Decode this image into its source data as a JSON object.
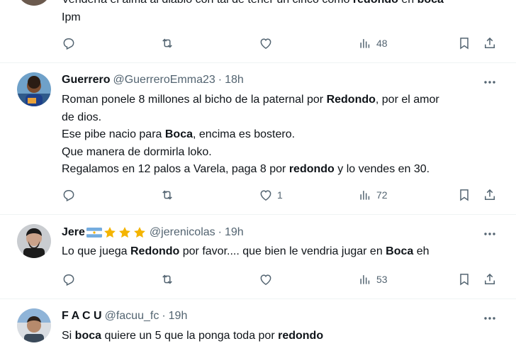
{
  "tweets": [
    {
      "body_lines": [
        [
          {
            "t": "Vendería el alma al diablo con tal de tener un cinco como "
          },
          {
            "t": "redondo",
            "b": true
          },
          {
            "t": " en "
          },
          {
            "t": "boca",
            "b": true
          }
        ],
        [
          {
            "t": "Ipm"
          }
        ]
      ],
      "stats": {
        "views": "48"
      }
    },
    {
      "name": "Guerrero",
      "handle": "@GuerreroEmma23",
      "time": "18h",
      "body_lines": [
        [
          {
            "t": "Roman ponele 8 millones al bicho de la paternal por "
          },
          {
            "t": "Redondo",
            "b": true
          },
          {
            "t": ", por el amor"
          }
        ],
        [
          {
            "t": "de dios."
          }
        ],
        [
          {
            "t": "Ese pibe nacio para "
          },
          {
            "t": "Boca",
            "b": true
          },
          {
            "t": ", encima es bostero."
          }
        ],
        [
          {
            "t": "Que manera de dormirla loko."
          }
        ],
        [
          {
            "t": "Regalamos en 12 palos a Varela, paga 8 por "
          },
          {
            "t": "redondo",
            "b": true
          },
          {
            "t": " y lo vendes en 30."
          }
        ]
      ],
      "stats": {
        "likes": "1",
        "views": "72"
      }
    },
    {
      "name": "Jere",
      "handle": "@jerenicolas",
      "time": "19h",
      "body_lines": [
        [
          {
            "t": "Lo que juega "
          },
          {
            "t": "Redondo",
            "b": true
          },
          {
            "t": " por favor.... que bien le vendria jugar en "
          },
          {
            "t": "Boca",
            "b": true
          },
          {
            "t": " eh"
          }
        ]
      ],
      "stats": {
        "views": "53"
      }
    },
    {
      "name": "F A C U",
      "handle": "@facuu_fc",
      "time": "19h",
      "body_lines": [
        [
          {
            "t": "Si "
          },
          {
            "t": "boca",
            "b": true
          },
          {
            "t": " quiere un 5 que la ponga toda por "
          },
          {
            "t": "redondo",
            "b": true
          }
        ]
      ]
    }
  ],
  "separator": "·",
  "icons": {
    "reply": "reply-icon",
    "retweet": "retweet-icon",
    "like": "heart-icon",
    "views": "views-icon",
    "bookmark": "bookmark-icon",
    "share": "share-icon",
    "more": "more-icon"
  },
  "colors": {
    "text": "#0f1419",
    "muted": "#536471",
    "divider": "#eff3f4",
    "star": "#f4b400",
    "flag_blue": "#74acdf"
  }
}
